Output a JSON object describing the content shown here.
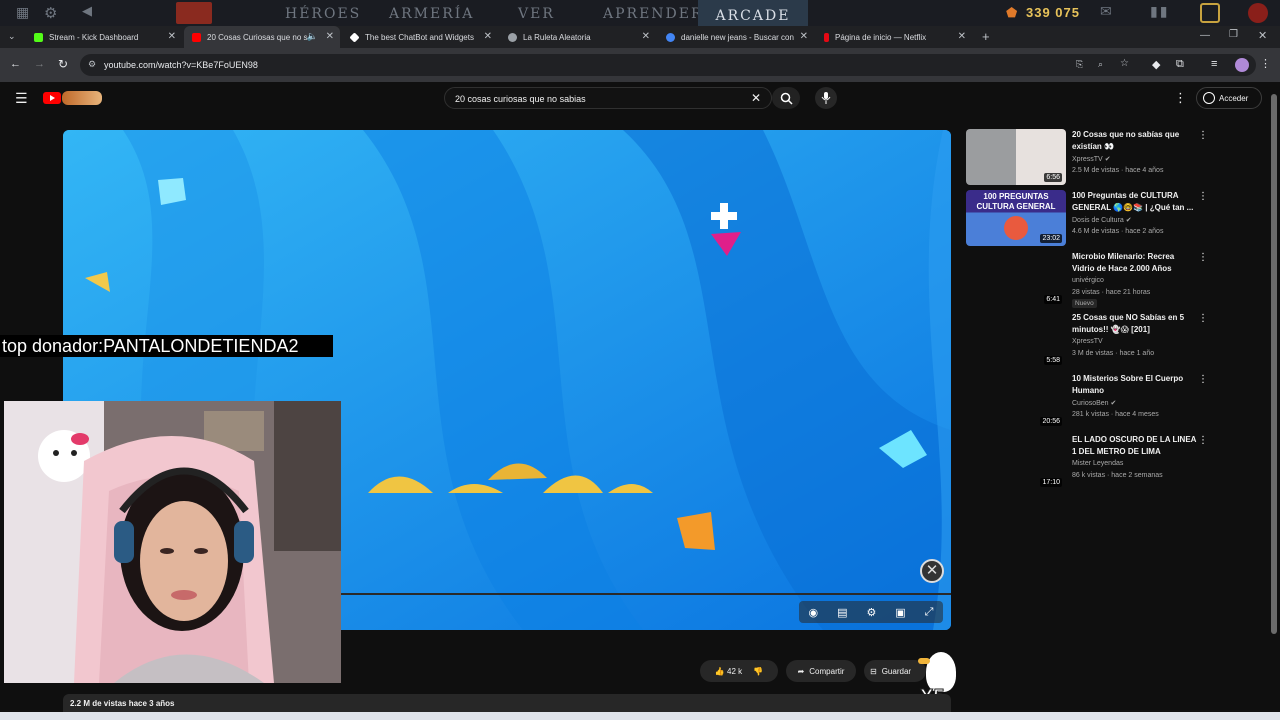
{
  "game_bar": {
    "nav": [
      "HÉROES",
      "ARMERÍA",
      "VER",
      "APRENDER"
    ],
    "active": "ARCADE",
    "shards": "339 075",
    "accent": "#2b3a4a"
  },
  "tabs": [
    {
      "label": "Stream - Kick Dashboard",
      "color": "#53fc18"
    },
    {
      "label": "20 Cosas Curiosas que no s",
      "color": "#ff0000",
      "active": true
    },
    {
      "label": "The best ChatBot and Widgets",
      "color": "#ffffff"
    },
    {
      "label": "La Ruleta Aleatoria",
      "color": "#9aa0a6"
    },
    {
      "label": "danielle new jeans - Buscar con",
      "color": "#4285f4"
    },
    {
      "label": "Página de inicio — Netflix",
      "color": "#e50914"
    }
  ],
  "address_bar": {
    "url": "youtube.com/watch?v=KBe7FoUEN98"
  },
  "youtube": {
    "search_value": "20 cosas curiosas que no sabias",
    "sign_in": "Acceder"
  },
  "overlay": {
    "donor_text": "top donador:PANTALONDETIENDA2"
  },
  "video": {
    "views_line": "2.2 M de vistas  hace 3 años",
    "likes": "42 k",
    "share": "Compartir",
    "save": "Guardar",
    "sticker": "X5"
  },
  "related": [
    {
      "title": "20 Cosas que no sabías que existían 👀",
      "channel": "XpressTV",
      "verified": true,
      "meta": "2.5 M de vistas · hace 4 años",
      "duration": "6:56",
      "thumb": "gray-house"
    },
    {
      "title": "100 Preguntas de CULTURA GENERAL 🌎🤓📚 | ¿Qué tan ...",
      "channel": "Dosis de Cultura",
      "verified": true,
      "meta": "4.6 M de vistas · hace 2 años",
      "duration": "23:02",
      "thumb": "quiz",
      "thumb_text": "100 PREGUNTAS CULTURA GENERAL"
    },
    {
      "title": "Microbio Milenario: Recrea Vidrio de Hace 2.000 Años",
      "channel": "univérgico",
      "verified": false,
      "meta": "28 vistas · hace 21 horas",
      "duration": "6:41",
      "badge": "Nuevo"
    },
    {
      "title": "25 Cosas que NO Sabías en 5 minutos!! 👻😱 [201]",
      "channel": "XpressTV",
      "verified": true,
      "meta": "3 M de vistas · hace 1 año",
      "duration": "5:58"
    },
    {
      "title": "10 Misterios Sobre El Cuerpo Humano",
      "channel": "CuriosoBen",
      "verified": true,
      "meta": "281 k vistas · hace 4 meses",
      "duration": "20:56"
    },
    {
      "title": "EL LADO OSCURO DE LA LINEA 1 DEL METRO DE LIMA",
      "channel": "Mister Leyendas",
      "verified": false,
      "meta": "86 k vistas · hace 2 semanas",
      "duration": "17:10"
    }
  ]
}
